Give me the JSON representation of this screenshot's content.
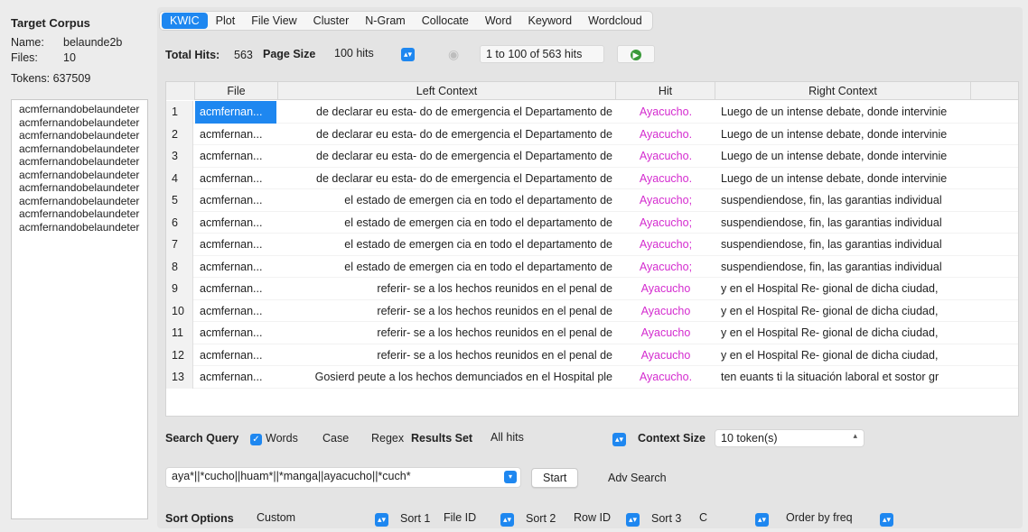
{
  "sidebar": {
    "title": "Target Corpus",
    "name_label": "Name:",
    "name_value": "belaunde2b",
    "files_label": "Files:",
    "files_value": "10",
    "tokens_label": "Tokens:",
    "tokens_value": "637509",
    "files": [
      "acmfernandobelaundeter",
      "acmfernandobelaundeter",
      "acmfernandobelaundeter",
      "acmfernandobelaundeter",
      "acmfernandobelaundeter",
      "acmfernandobelaundeter",
      "acmfernandobelaundeter",
      "acmfernandobelaundeter",
      "acmfernandobelaundeter",
      "acmfernandobelaundeter"
    ]
  },
  "tabs": [
    "KWIC",
    "Plot",
    "File View",
    "Cluster",
    "N-Gram",
    "Collocate",
    "Word",
    "Keyword",
    "Wordcloud"
  ],
  "active_tab": "KWIC",
  "top": {
    "total_hits_label": "Total Hits:",
    "total_hits_value": "563",
    "page_size_label": "Page Size",
    "page_size_value": "100 hits",
    "range_text": "1 to 100 of 563 hits"
  },
  "table": {
    "headers": [
      "File",
      "Left Context",
      "Hit",
      "Right Context"
    ],
    "rows": [
      {
        "n": "1",
        "file": "acmfernan...",
        "left": "de declarar eu esta- do de emergencia el Departamento de",
        "hit": "Ayacucho.",
        "right": "Luego de un intense debate, donde intervinie"
      },
      {
        "n": "2",
        "file": "acmfernan...",
        "left": "de declarar eu esta- do de emergencia el Departamento de",
        "hit": "Ayacucho.",
        "right": "Luego de un intense debate, donde intervinie"
      },
      {
        "n": "3",
        "file": "acmfernan...",
        "left": "de declarar eu esta- do de emergencia el Departamento de",
        "hit": "Ayacucho.",
        "right": "Luego de un intense debate, donde intervinie"
      },
      {
        "n": "4",
        "file": "acmfernan...",
        "left": "de declarar eu esta- do de emergencia el Departamento de",
        "hit": "Ayacucho.",
        "right": "Luego de un intense debate, donde intervinie"
      },
      {
        "n": "5",
        "file": "acmfernan...",
        "left": "el estado de emergen cia en todo el departamento de",
        "hit": "Ayacucho;",
        "right": "suspendiendose, fin, las garantias individual"
      },
      {
        "n": "6",
        "file": "acmfernan...",
        "left": "el estado de emergen cia en todo el departamento de",
        "hit": "Ayacucho;",
        "right": "suspendiendose, fin, las garantias individual"
      },
      {
        "n": "7",
        "file": "acmfernan...",
        "left": "el estado de emergen cia en todo el departamento de",
        "hit": "Ayacucho;",
        "right": "suspendiendose, fin, las garantias individual"
      },
      {
        "n": "8",
        "file": "acmfernan...",
        "left": "el estado de emergen cia en todo el departamento de",
        "hit": "Ayacucho;",
        "right": "suspendiendose, fin, las garantias individual"
      },
      {
        "n": "9",
        "file": "acmfernan...",
        "left": "referir- se a los hechos reunidos en el penal de",
        "hit": "Ayacucho",
        "right": "y en el Hospital Re- gional de dicha ciudad,"
      },
      {
        "n": "10",
        "file": "acmfernan...",
        "left": "referir- se a los hechos reunidos en el penal de",
        "hit": "Ayacucho",
        "right": "y en el Hospital Re- gional de dicha ciudad,"
      },
      {
        "n": "11",
        "file": "acmfernan...",
        "left": "referir- se a los hechos reunidos en el penal de",
        "hit": "Ayacucho",
        "right": "y en el Hospital Re- gional de dicha ciudad,"
      },
      {
        "n": "12",
        "file": "acmfernan...",
        "left": "referir- se a los hechos reunidos en el penal de",
        "hit": "Ayacucho",
        "right": "y en el Hospital Re- gional de dicha ciudad,"
      },
      {
        "n": "13",
        "file": "acmfernan...",
        "left": "Gosierd peute a los hechos demunciados en el Hospital ple",
        "hit": "Ayacucho.",
        "right": "ten euants ti la situación laboral et sostor gr"
      }
    ]
  },
  "search": {
    "query_label": "Search Query",
    "words_label": "Words",
    "case_label": "Case",
    "regex_label": "Regex",
    "results_set_label": "Results Set",
    "results_set_value": "All hits",
    "context_size_label": "Context Size",
    "context_size_value": "10 token(s)",
    "query_value": "aya*||*cucho||huam*||*manga||ayacucho||*cuch*",
    "start_label": "Start",
    "adv_search_label": "Adv Search"
  },
  "sort": {
    "label": "Sort Options",
    "mode": "Custom",
    "sort1_label": "Sort 1",
    "sort1_value": "File ID",
    "sort2_label": "Sort 2",
    "sort2_value": "Row ID",
    "sort3_label": "Sort 3",
    "sort3_value": "C",
    "order_value": "Order by freq"
  },
  "colors": {
    "accent": "#1e87f0",
    "hit": "#d42bcf"
  }
}
